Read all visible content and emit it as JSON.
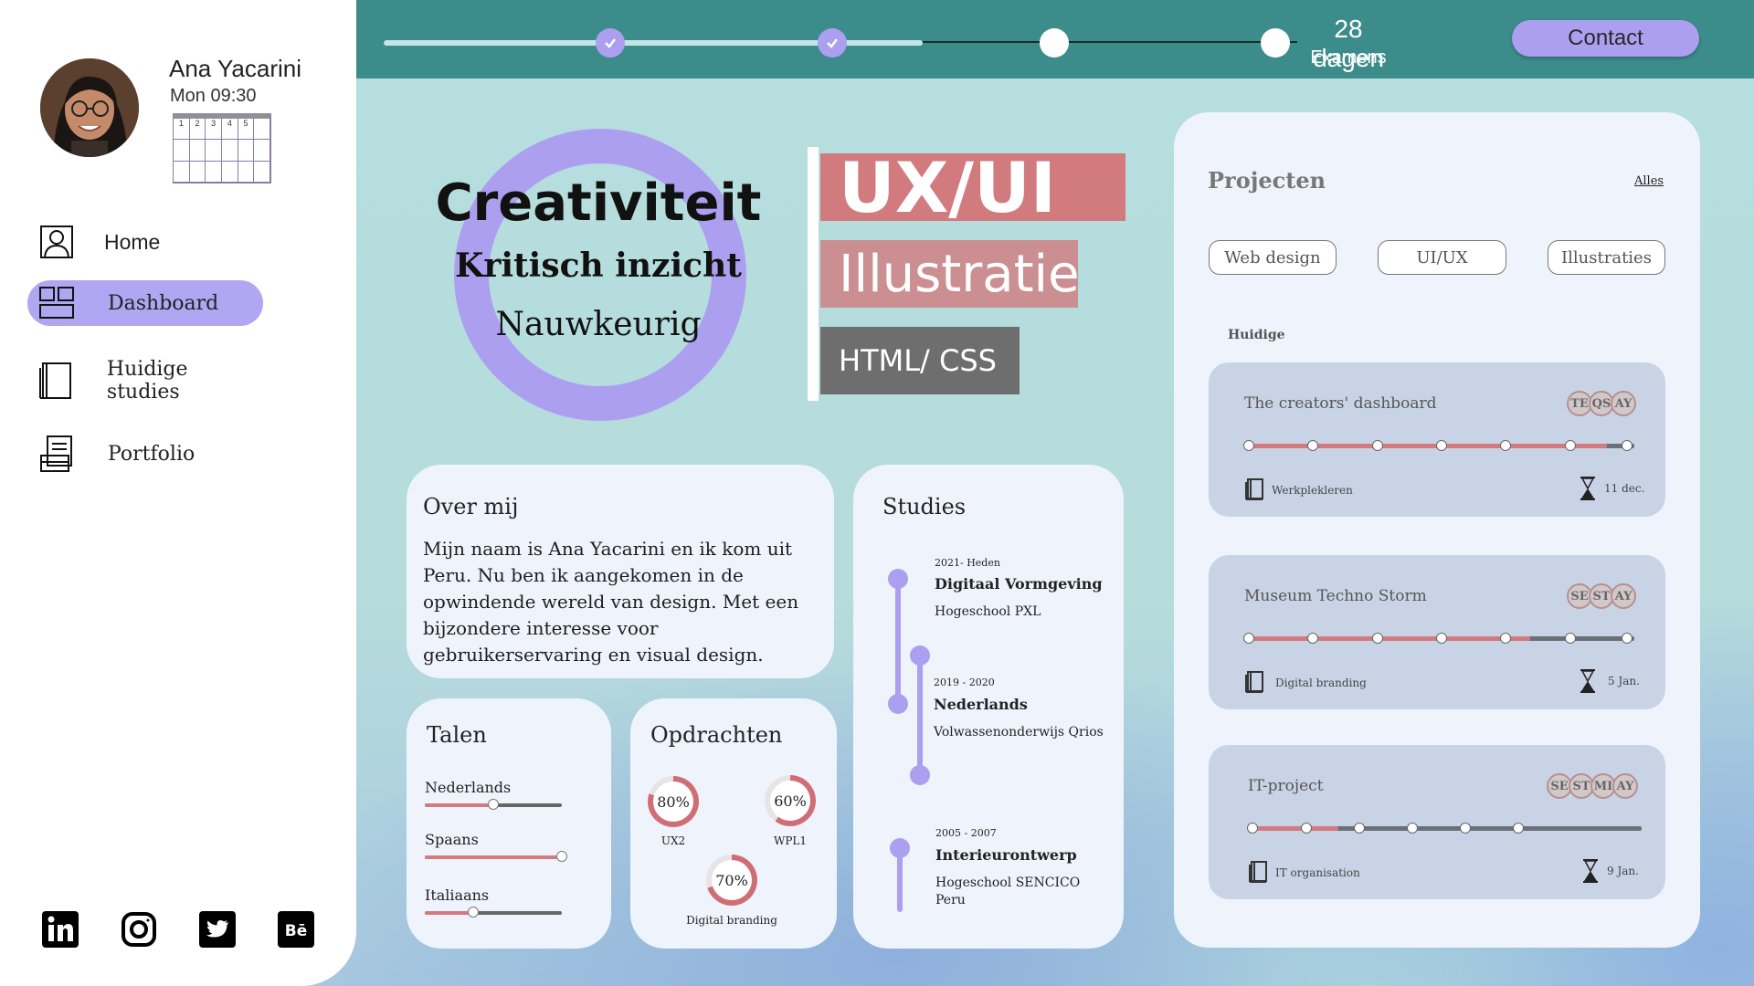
{
  "profile": {
    "name": "Ana Yacarini",
    "time": "Mon 09:30",
    "calendar_days": [
      "1",
      "2",
      "3",
      "4",
      "5"
    ]
  },
  "nav": {
    "items": [
      {
        "label": "Home",
        "icon": "user-icon"
      },
      {
        "label": "Dashboard",
        "icon": "dashboard-icon",
        "active": true
      },
      {
        "label": "Huidige studies",
        "icon": "book-icon"
      },
      {
        "label": "Portfolio",
        "icon": "portfolio-icon"
      }
    ]
  },
  "socials": [
    "linkedin-icon",
    "instagram-icon",
    "twitter-icon",
    "behance-icon"
  ],
  "topbar": {
    "steps": [
      {
        "state": "done"
      },
      {
        "state": "done"
      },
      {
        "state": "todo"
      },
      {
        "state": "todo"
      }
    ],
    "progress_fraction": 0.59,
    "exam_days": "28 dagen",
    "exam_label": "Examens",
    "contact_label": "Contact"
  },
  "hero": {
    "line1": "Creativiteit",
    "line2": "Kritisch inzicht",
    "line3": "Nauwkeurig",
    "skills": [
      "UX/UI",
      "Illustratie",
      "HTML/ CSS"
    ]
  },
  "about": {
    "title": "Over mij",
    "text": "Mijn naam is Ana Yacarini en ik kom uit Peru. Nu ben ik aangekomen in de opwindende wereld van design. Met een bijzondere interesse voor gebruikerservaring en visual design."
  },
  "languages": {
    "title": "Talen",
    "items": [
      {
        "name": "Nederlands",
        "level": 0.5
      },
      {
        "name": "Spaans",
        "level": 1.0
      },
      {
        "name": "Italiaans",
        "level": 0.35
      }
    ]
  },
  "assignments": {
    "title": "Opdrachten",
    "items": [
      {
        "value": "80%",
        "pct": 80,
        "label": "UX2"
      },
      {
        "value": "60%",
        "pct": 60,
        "label": "WPL1"
      },
      {
        "value": "70%",
        "pct": 70,
        "label": "Digital branding"
      }
    ]
  },
  "studies": {
    "title": "Studies",
    "items": [
      {
        "date": "2021- Heden",
        "title": "Digitaal Vormgeving",
        "school": "Hogeschool PXL"
      },
      {
        "date": "2019 - 2020",
        "title": "Nederlands",
        "school": "Volwassenonderwijs Qrios"
      },
      {
        "date": "2005 - 2007",
        "title": "Interieurontwerp",
        "school": "Hogeschool SENCICO",
        "school2": "Peru"
      }
    ]
  },
  "projects": {
    "title": "Projecten",
    "all_label": "Alles",
    "filters": [
      "Web design",
      "UI/UX",
      "Illustraties"
    ],
    "current_label": "Huidige",
    "items": [
      {
        "name": "The creators' dashboard",
        "members": [
          "TE",
          "QS",
          "AY"
        ],
        "progress": 0.93,
        "course": "Werkplekleren",
        "due": "11 dec."
      },
      {
        "name": "Museum Techno Storm",
        "members": [
          "SE",
          "ST",
          "AY"
        ],
        "progress": 0.73,
        "course": "Digital branding",
        "due": "5 Jan."
      },
      {
        "name": "IT-project",
        "members": [
          "SE",
          "ST",
          "MI",
          "AY"
        ],
        "progress": 0.22,
        "course": "IT organisation",
        "due": "9 Jan."
      }
    ]
  },
  "colors": {
    "accent": "#ac9ff0",
    "teal": "#3d8c8c",
    "rose": "#d27b7e",
    "panel": "#eff4fc"
  }
}
